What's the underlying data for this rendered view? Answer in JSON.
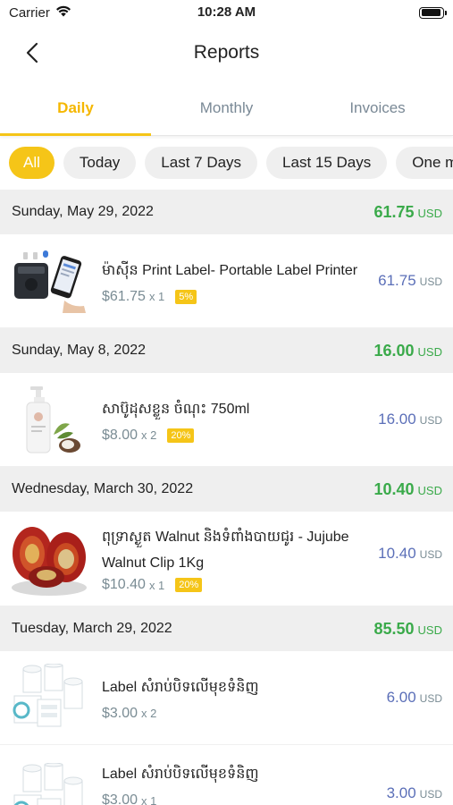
{
  "status": {
    "carrier": "Carrier",
    "time": "10:28 AM",
    "battery_level": 0.95
  },
  "nav": {
    "title": "Reports"
  },
  "tabs": [
    {
      "label": "Daily",
      "active": true
    },
    {
      "label": "Monthly",
      "active": false
    },
    {
      "label": "Invoices",
      "active": false
    }
  ],
  "filters": [
    {
      "label": "All",
      "active": true
    },
    {
      "label": "Today",
      "active": false
    },
    {
      "label": "Last 7 Days",
      "active": false
    },
    {
      "label": "Last 15 Days",
      "active": false
    },
    {
      "label": "One m",
      "active": false
    }
  ],
  "groups": [
    {
      "date": "Sunday, May 29, 2022",
      "total": "61.75",
      "unit": "USD",
      "items": [
        {
          "name": "ម៉ាស៊ីន Print Label- Portable Label Printer",
          "price": "$61.75",
          "qty": "x 1",
          "discount": "5%",
          "amount": "61.75",
          "unit": "USD",
          "image": "label-printer-image"
        }
      ]
    },
    {
      "date": "Sunday, May 8, 2022",
      "total": "16.00",
      "unit": "USD",
      "items": [
        {
          "name": "សាប៊ូដុសខ្លួន ចំណុះ 750ml",
          "price": "$8.00",
          "qty": "x 2",
          "discount": "20%",
          "amount": "16.00",
          "unit": "USD",
          "image": "soap-bottle-image"
        }
      ]
    },
    {
      "date": "Wednesday, March 30, 2022",
      "total": "10.40",
      "unit": "USD",
      "items": [
        {
          "name": "ពុទ្រាស្ងួត Walnut និងទំពាំងបាយជូរ - Jujube Walnut Clip 1Kg",
          "price": "$10.40",
          "qty": "x 1",
          "discount": "20%",
          "amount": "10.40",
          "unit": "USD",
          "image": "jujube-walnut-image"
        }
      ]
    },
    {
      "date": "Tuesday, March 29, 2022",
      "total": "85.50",
      "unit": "USD",
      "items": [
        {
          "name": "Label សំរាប់បិទលើមុខទំនិញ",
          "price": "$3.00",
          "qty": "x 2",
          "discount": "",
          "amount": "6.00",
          "unit": "USD",
          "image": "label-rolls-image"
        },
        {
          "name": "Label សំរាប់បិទលើមុខទំនិញ",
          "price": "$3.00",
          "qty": "x 1",
          "discount": "",
          "amount": "3.00",
          "unit": "USD",
          "image": "label-rolls-image"
        }
      ]
    }
  ],
  "colors": {
    "accent": "#f5c518",
    "total_green": "#3aaa4a",
    "amount_blue": "#5b6fb8"
  }
}
